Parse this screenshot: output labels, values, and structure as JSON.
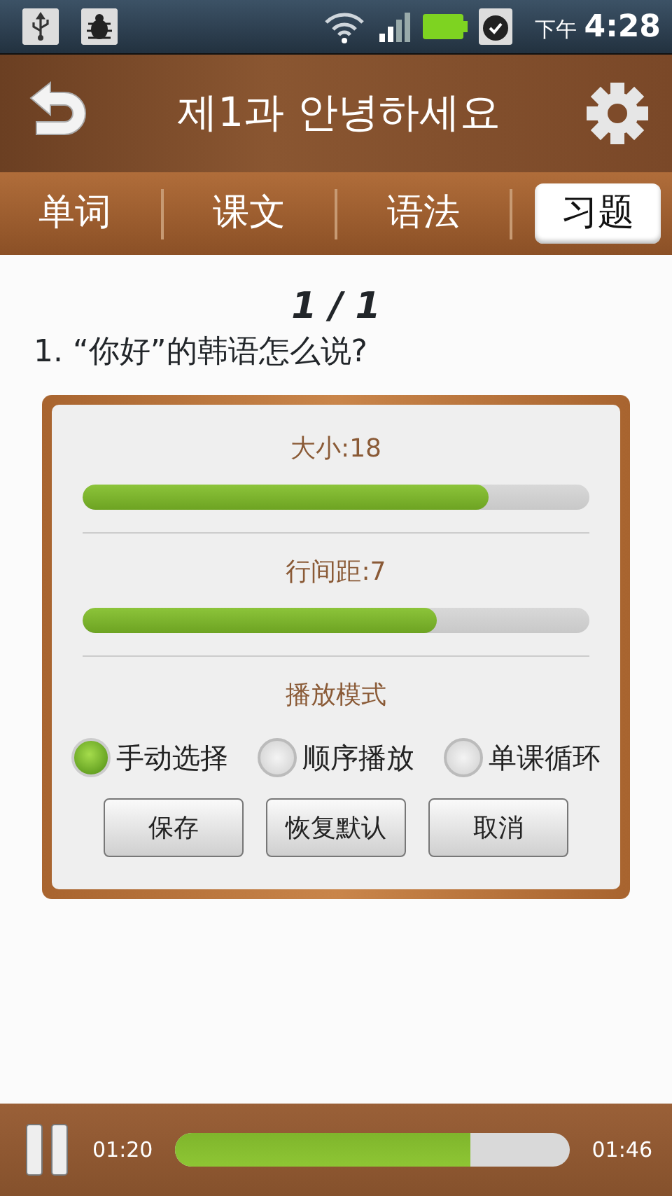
{
  "status_bar": {
    "time_period": "下午",
    "time": "4:28"
  },
  "header": {
    "title": "제1과 안녕하세요"
  },
  "tabs": [
    {
      "label": "单词",
      "selected": false
    },
    {
      "label": "课文",
      "selected": false
    },
    {
      "label": "语法",
      "selected": false
    },
    {
      "label": "习题",
      "selected": true
    }
  ],
  "content": {
    "page": "1 / 1",
    "question": "1. “你好”的韩语怎么说?"
  },
  "dialog": {
    "sliders": [
      {
        "label": "大小:18",
        "level": 0.8
      },
      {
        "label": "行间距:7",
        "level": 0.7
      }
    ],
    "mode_title": "播放模式",
    "modes": [
      {
        "label": "手动选择",
        "selected": true
      },
      {
        "label": "顺序播放",
        "selected": false
      },
      {
        "label": "单课循环",
        "selected": false
      }
    ],
    "buttons": [
      "保存",
      "恢复默认",
      "取消"
    ]
  },
  "player": {
    "playing": true,
    "elapsed": "01:20",
    "total": "01:46",
    "level": 0.75
  }
}
